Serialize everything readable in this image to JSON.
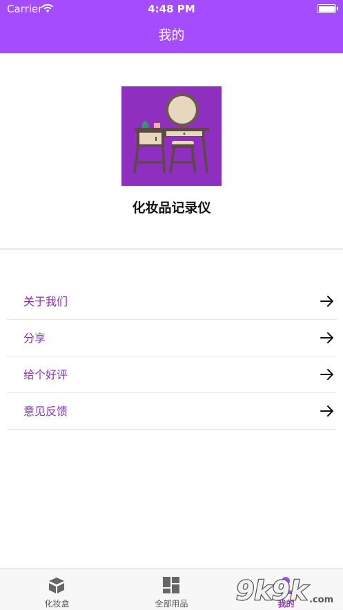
{
  "status_bar": {
    "carrier": "Carrier",
    "time": "4:48 PM"
  },
  "nav": {
    "title": "我的"
  },
  "app": {
    "name": "化妆品记录仪",
    "icon": "vanity-table-icon"
  },
  "menu": {
    "items": [
      {
        "label": "关于我们",
        "icon": "arrow-right-icon"
      },
      {
        "label": "分享",
        "icon": "arrow-right-icon"
      },
      {
        "label": "给个好评",
        "icon": "arrow-right-icon"
      },
      {
        "label": "意见反馈",
        "icon": "arrow-right-icon"
      }
    ]
  },
  "tabs": [
    {
      "label": "化妆盒",
      "icon": "box-icon",
      "active": false
    },
    {
      "label": "全部用品",
      "icon": "grid-icon",
      "active": false
    },
    {
      "label": "我的",
      "icon": "person-icon",
      "active": true
    }
  ],
  "watermark": {
    "text": "9k9k.com"
  },
  "colors": {
    "accent": "#a64cff",
    "menu_text": "#8f2fb8",
    "icon_bg": "#8f2fbf"
  }
}
